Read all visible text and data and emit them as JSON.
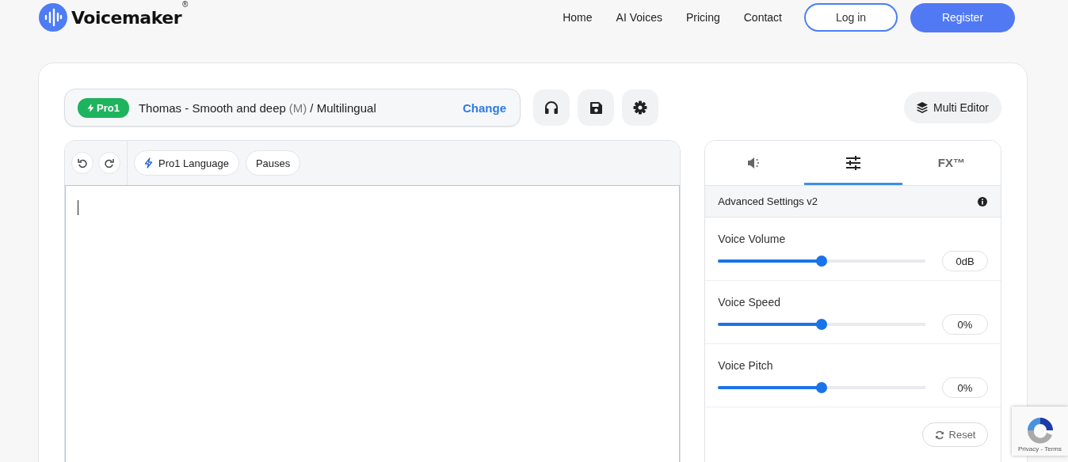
{
  "brand": {
    "name": "Voicemaker",
    "mark": "®"
  },
  "nav": [
    {
      "label": "Home"
    },
    {
      "label": "AI Voices"
    },
    {
      "label": "Pricing"
    },
    {
      "label": "Contact"
    }
  ],
  "auth": {
    "login": "Log in",
    "register": "Register"
  },
  "voice": {
    "badge": "Pro1",
    "name": "Thomas - Smooth and deep",
    "gender": "(M)",
    "language": "/ Multilingual",
    "change": "Change"
  },
  "multi_editor": "Multi Editor",
  "editor_toolbar": {
    "chips": [
      {
        "label": "Pro1 Language",
        "kind": "bolt"
      },
      {
        "label": "Pauses",
        "kind": "plain"
      }
    ]
  },
  "panel": {
    "tabs": [
      {
        "kind": "speaker",
        "selected": false
      },
      {
        "kind": "sliders",
        "selected": true
      },
      {
        "kind": "text",
        "label": "FX™",
        "selected": false
      }
    ],
    "header": "Advanced Settings v2",
    "sliders": [
      {
        "label": "Voice Volume",
        "level": 0.5,
        "reading": "0dB"
      },
      {
        "label": "Voice Speed",
        "level": 0.5,
        "reading": "0%"
      },
      {
        "label": "Voice Pitch",
        "level": 0.5,
        "reading": "0%"
      }
    ],
    "reset": "Reset"
  },
  "recaptcha": {
    "links": "Privacy - Terms"
  }
}
